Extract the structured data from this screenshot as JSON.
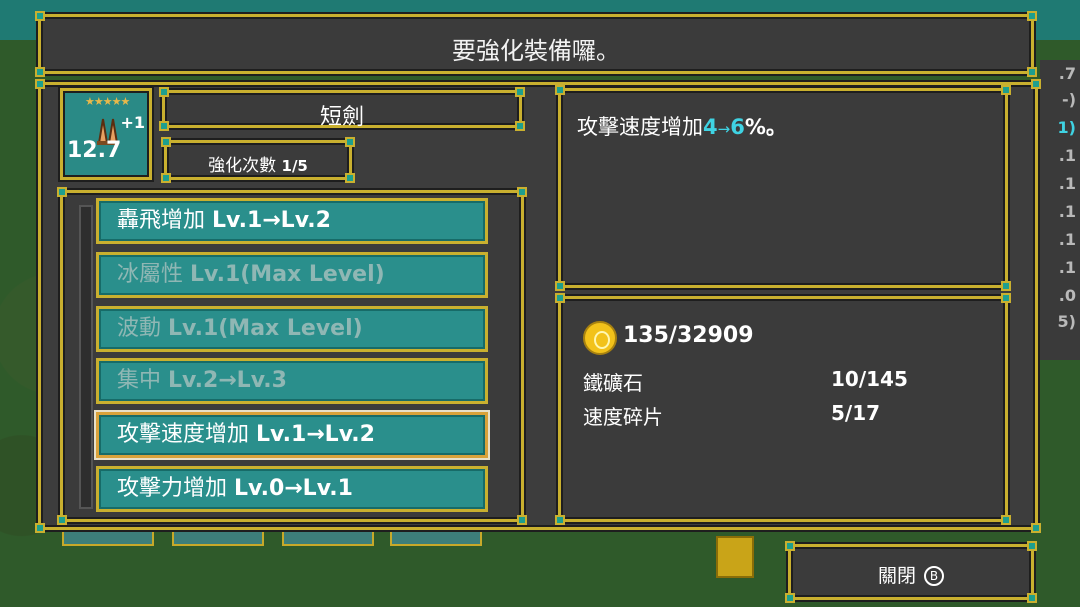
{
  "dialog": {
    "title": "要強化裝備囉。"
  },
  "weapon": {
    "name": "短劍",
    "stars": "★★★★★",
    "level_badge": "+1",
    "value": "12.7",
    "enhance_label": "強化次數",
    "enhance_count": "1/5"
  },
  "options": [
    {
      "name": "轟飛增加",
      "level": "Lv.1→Lv.2",
      "state": "enabled"
    },
    {
      "name": "冰屬性",
      "level": "Lv.1(Max Level)",
      "state": "disabled"
    },
    {
      "name": "波動",
      "level": "Lv.1(Max Level)",
      "state": "disabled"
    },
    {
      "name": "集中",
      "level": "Lv.2→Lv.3",
      "state": "disabled"
    },
    {
      "name": "攻擊速度增加",
      "level": "Lv.1→Lv.2",
      "state": "selected"
    },
    {
      "name": "攻擊力增加",
      "level": "Lv.0→Lv.1",
      "state": "enabled"
    }
  ],
  "description": {
    "prefix": "攻擊速度增加",
    "from": "4",
    "arrow": "→",
    "to": "6",
    "suffix": "%。"
  },
  "cost": {
    "gold": "135/32909",
    "materials": [
      {
        "name": "鐵礦石",
        "amount": "10/145"
      },
      {
        "name": "速度碎片",
        "amount": "5/17"
      }
    ]
  },
  "close_button": {
    "label": "關閉",
    "button_glyph": "B"
  },
  "background": {
    "stats": [
      ".7",
      "-)",
      "1)",
      ".1",
      ".1",
      ".1",
      ".1",
      ".1",
      ".0",
      "5)"
    ]
  },
  "colors": {
    "frame": "#c9b02f",
    "option_bg": "#2a8f8c",
    "highlight": "#3fd3e3",
    "gold": "#f2c21a"
  },
  "icons": {
    "coin": "gold-coin-icon",
    "weapon": "dagger-icon",
    "b_button": "b-button-icon"
  }
}
